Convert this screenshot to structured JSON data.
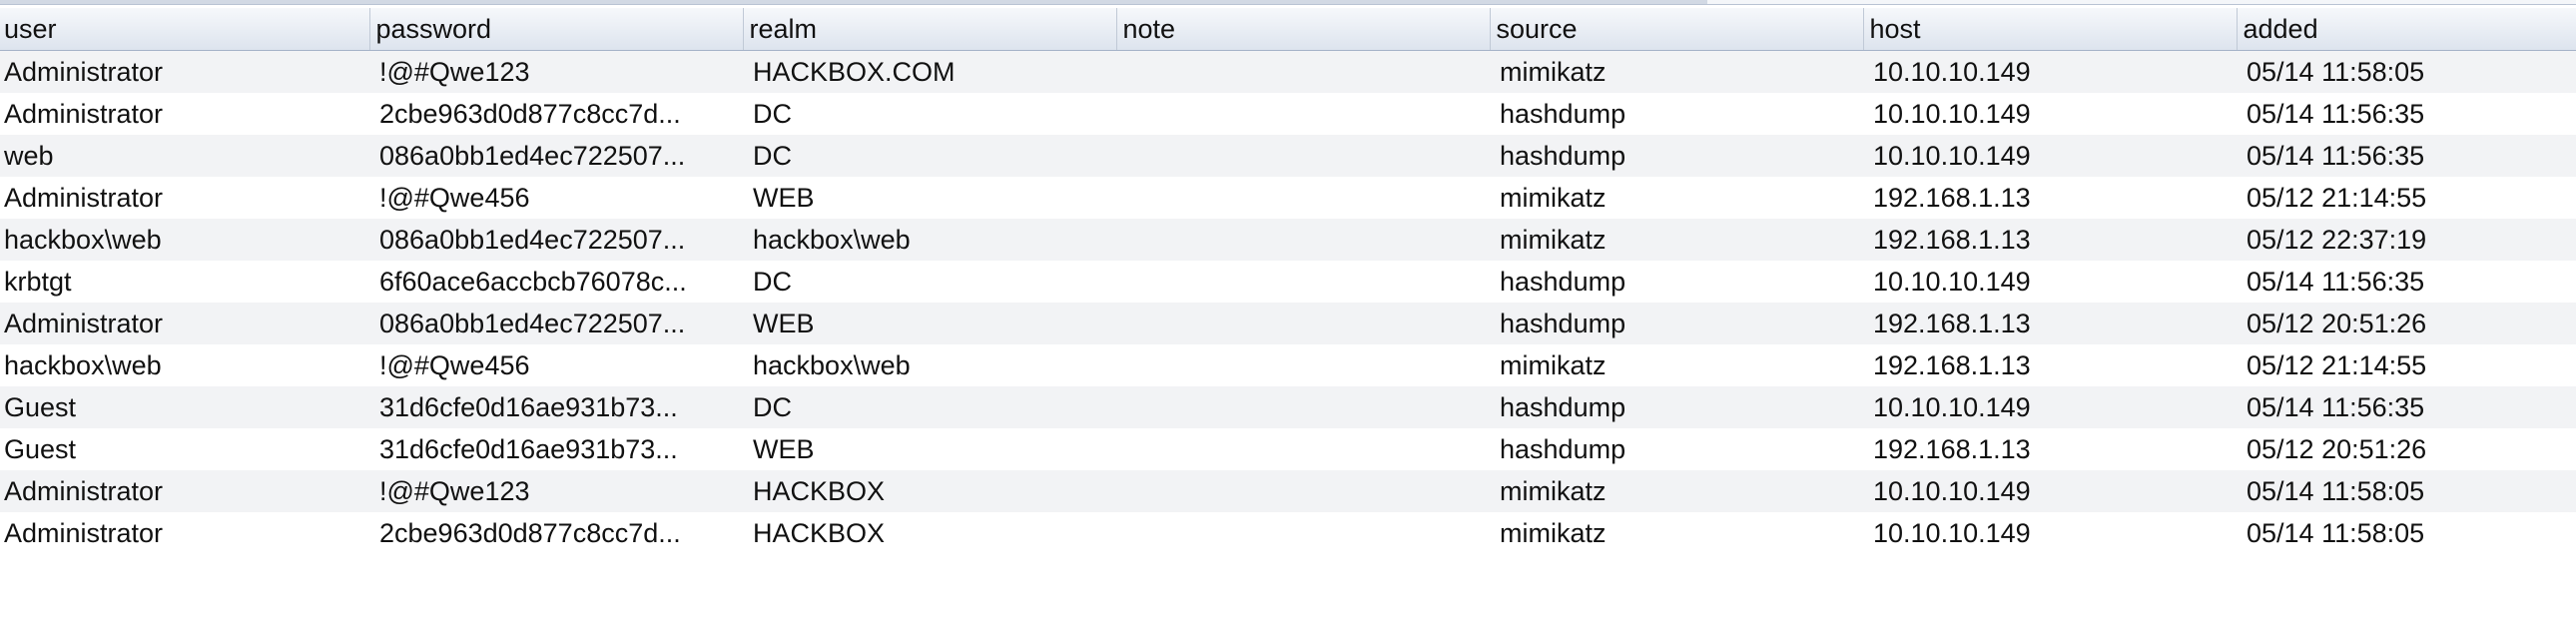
{
  "table": {
    "columns": [
      "user",
      "password",
      "realm",
      "note",
      "source",
      "host",
      "added"
    ],
    "rows": [
      [
        "Administrator",
        "!@#Qwe123",
        "HACKBOX.COM",
        "",
        "mimikatz",
        "10.10.10.149",
        "05/14 11:58:05"
      ],
      [
        "Administrator",
        "2cbe963d0d877c8cc7d...",
        "DC",
        "",
        "hashdump",
        "10.10.10.149",
        "05/14 11:56:35"
      ],
      [
        "web",
        "086a0bb1ed4ec722507...",
        "DC",
        "",
        "hashdump",
        "10.10.10.149",
        "05/14 11:56:35"
      ],
      [
        "Administrator",
        "!@#Qwe456",
        "WEB",
        "",
        "mimikatz",
        "192.168.1.13",
        "05/12 21:14:55"
      ],
      [
        "hackbox\\web",
        "086a0bb1ed4ec722507...",
        "hackbox\\web",
        "",
        "mimikatz",
        "192.168.1.13",
        "05/12 22:37:19"
      ],
      [
        "krbtgt",
        "6f60ace6accbcb76078c...",
        "DC",
        "",
        "hashdump",
        "10.10.10.149",
        "05/14 11:56:35"
      ],
      [
        "Administrator",
        "086a0bb1ed4ec722507...",
        "WEB",
        "",
        "hashdump",
        "192.168.1.13",
        "05/12 20:51:26"
      ],
      [
        "hackbox\\web",
        "!@#Qwe456",
        "hackbox\\web",
        "",
        "mimikatz",
        "192.168.1.13",
        "05/12 21:14:55"
      ],
      [
        "Guest",
        "31d6cfe0d16ae931b73...",
        "DC",
        "",
        "hashdump",
        "10.10.10.149",
        "05/14 11:56:35"
      ],
      [
        "Guest",
        "31d6cfe0d16ae931b73...",
        "WEB",
        "",
        "hashdump",
        "192.168.1.13",
        "05/12 20:51:26"
      ],
      [
        "Administrator",
        "!@#Qwe123",
        "HACKBOX",
        "",
        "mimikatz",
        "10.10.10.149",
        "05/14 11:58:05"
      ],
      [
        "Administrator",
        "2cbe963d0d877c8cc7d...",
        "HACKBOX",
        "",
        "mimikatz",
        "10.10.10.149",
        "05/14 11:58:05"
      ]
    ]
  }
}
